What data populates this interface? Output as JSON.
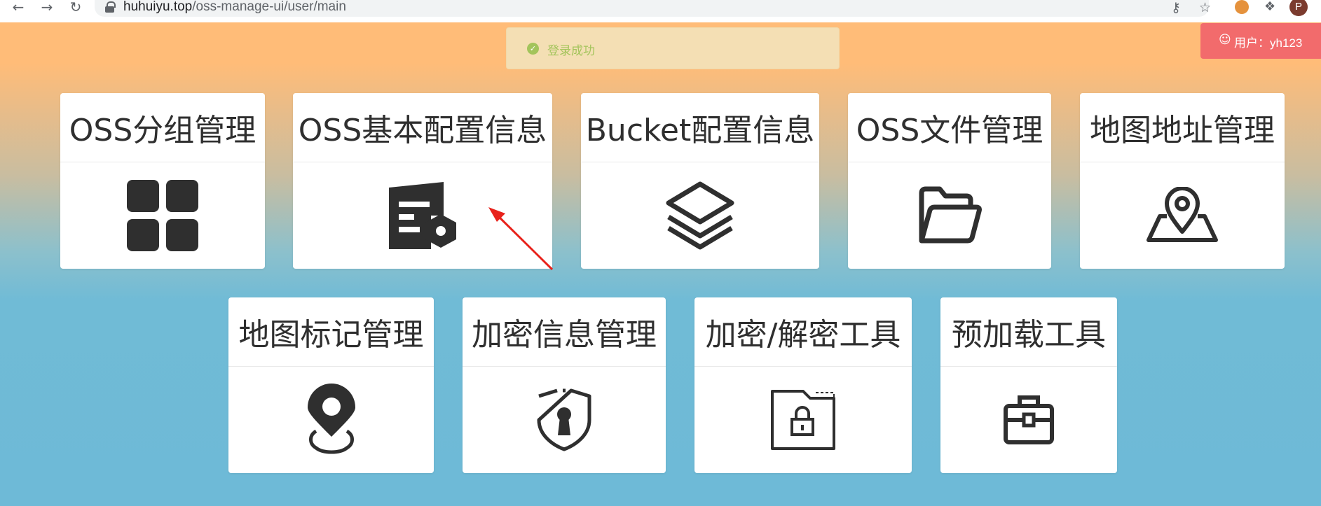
{
  "browser": {
    "url_host": "huhuiyu.top",
    "url_path": "/oss-manage-ui/user/main",
    "profile_initial": "P"
  },
  "toast": {
    "message": "登录成功",
    "icon": "check-circle-icon"
  },
  "user_badge": {
    "label": "用户：yh123",
    "icon": "user-icon"
  },
  "cards_row1": [
    {
      "title": "OSS分组管理",
      "icon": "grid-icon"
    },
    {
      "title": "OSS基本配置信息",
      "icon": "document-settings-icon"
    },
    {
      "title": "Bucket配置信息",
      "icon": "layers-icon"
    },
    {
      "title": "OSS文件管理",
      "icon": "folder-icon"
    },
    {
      "title": "地图地址管理",
      "icon": "map-pin-icon"
    }
  ],
  "cards_row2": [
    {
      "title": "地图标记管理",
      "icon": "location-marker-icon"
    },
    {
      "title": "加密信息管理",
      "icon": "shield-keyhole-icon"
    },
    {
      "title": "加密/解密工具",
      "icon": "locked-folder-icon"
    },
    {
      "title": "预加载工具",
      "icon": "toolbox-icon"
    }
  ],
  "colors": {
    "toast_bg": "#f4dfb4",
    "toast_text": "#a3c45b",
    "user_badge_bg": "#f26b6c",
    "icon_dark": "#2f2f2f",
    "annotation_arrow": "#e8221b"
  }
}
